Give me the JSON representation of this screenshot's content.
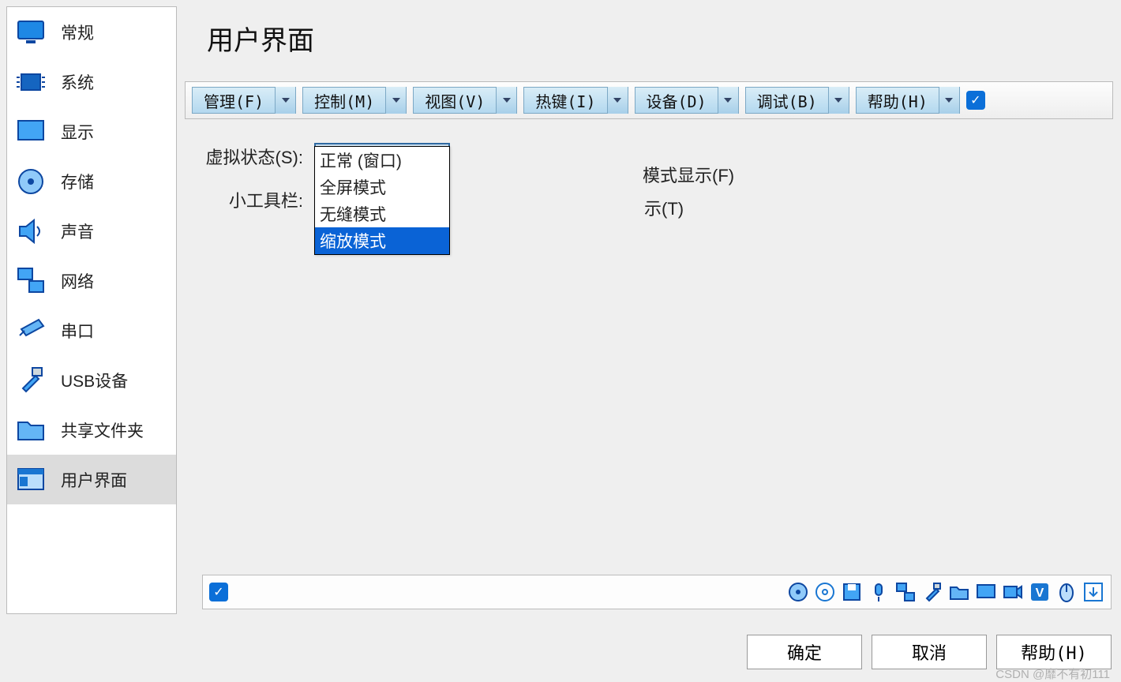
{
  "title": "用户界面",
  "sidebar": {
    "items": [
      {
        "label": "常规",
        "icon": "monitor"
      },
      {
        "label": "系统",
        "icon": "chip"
      },
      {
        "label": "显示",
        "icon": "display"
      },
      {
        "label": "存储",
        "icon": "disk"
      },
      {
        "label": "声音",
        "icon": "speaker"
      },
      {
        "label": "网络",
        "icon": "network"
      },
      {
        "label": "串口",
        "icon": "serial"
      },
      {
        "label": "USB设备",
        "icon": "usb"
      },
      {
        "label": "共享文件夹",
        "icon": "folder"
      },
      {
        "label": "用户界面",
        "icon": "ui",
        "selected": true
      }
    ]
  },
  "menubar": {
    "items": [
      "管理(F)",
      "控制(M)",
      "视图(V)",
      "热键(I)",
      "设备(D)",
      "调试(B)",
      "帮助(H)"
    ]
  },
  "form": {
    "virtual_state_label": "虚拟状态(S):",
    "virtual_state_value": "正常 (窗口)",
    "virtual_state_options": [
      "正常 (窗口)",
      "全屏模式",
      "无缝模式",
      "缩放模式"
    ],
    "virtual_state_highlight_index": 3,
    "toolbar_label": "小工具栏:",
    "behind_text_1": "模式显示(F)",
    "behind_text_2": "示(T)"
  },
  "buttons": {
    "ok": "确定",
    "cancel": "取消",
    "help": "帮助(H)"
  },
  "watermark": "CSDN @靡不有初111"
}
